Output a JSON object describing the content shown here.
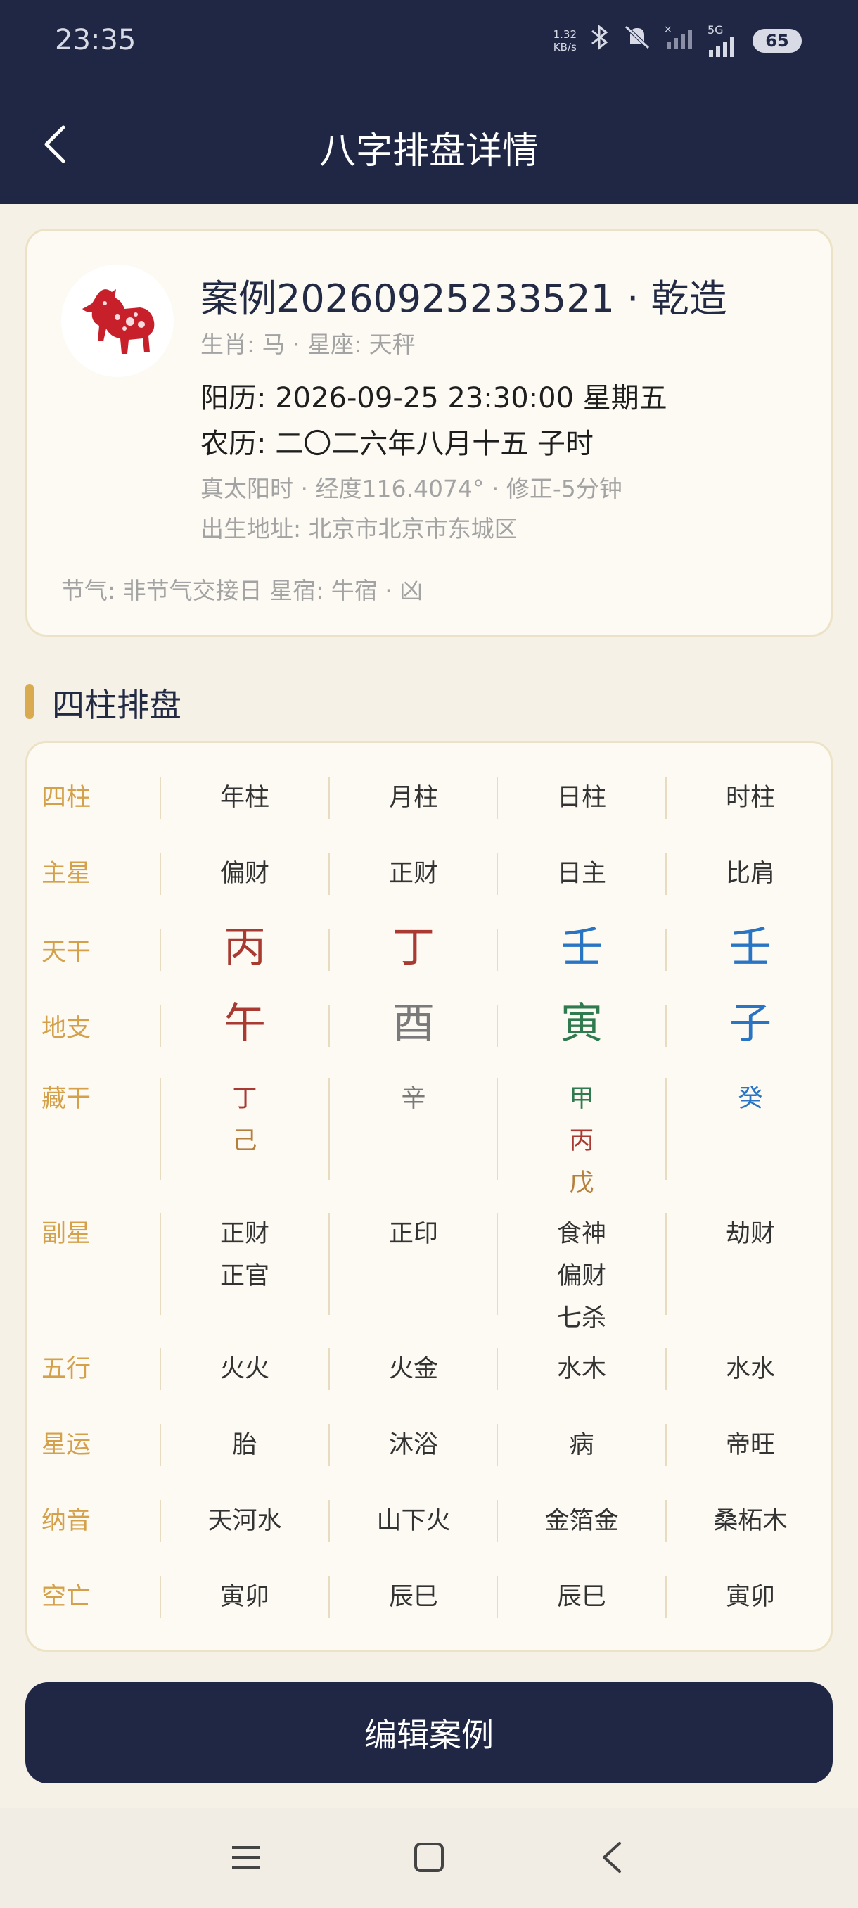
{
  "status": {
    "time": "23:35",
    "net_speed_value": "1.32",
    "net_speed_unit": "KB/s",
    "battery": "65",
    "network_label": "5G"
  },
  "header": {
    "title": "八字排盘详情"
  },
  "profile": {
    "case_title": "案例20260925233521 · 乾造",
    "zodiac_line": "生肖: 马 · 星座: 天秤",
    "solar_date": "阳历: 2026-09-25 23:30:00  星期五",
    "lunar_date": "农历: 二〇二六年八月十五 子时",
    "true_solar": "真太阳时 · 经度116.4074° · 修正-5分钟",
    "birthplace": "出生地址: 北京市北京市东城区",
    "footer": "节气: 非节气交接日  星宿: 牛宿 · 凶"
  },
  "section": {
    "title": "四柱排盘"
  },
  "pillars": {
    "rows": [
      {
        "label": "四柱",
        "cells": [
          [
            "年柱"
          ],
          [
            "月柱"
          ],
          [
            "日柱"
          ],
          [
            "时柱"
          ]
        ]
      },
      {
        "label": "主星",
        "cells": [
          [
            "偏财"
          ],
          [
            "正财"
          ],
          [
            "日主"
          ],
          [
            "比肩"
          ]
        ]
      },
      {
        "label": "天干",
        "cells": [
          [
            "丙"
          ],
          [
            "丁"
          ],
          [
            "壬"
          ],
          [
            "壬"
          ]
        ]
      },
      {
        "label": "地支",
        "cells": [
          [
            "午"
          ],
          [
            "酉"
          ],
          [
            "寅"
          ],
          [
            "子"
          ]
        ]
      },
      {
        "label": "藏干",
        "cells": [
          [
            "丁",
            "己"
          ],
          [
            "辛"
          ],
          [
            "甲",
            "丙",
            "戊"
          ],
          [
            "癸"
          ]
        ]
      },
      {
        "label": "副星",
        "cells": [
          [
            "正财",
            "正官"
          ],
          [
            "正印"
          ],
          [
            "食神",
            "偏财",
            "七杀"
          ],
          [
            "劫财"
          ]
        ]
      },
      {
        "label": "五行",
        "cells": [
          [
            "火火"
          ],
          [
            "火金"
          ],
          [
            "水木"
          ],
          [
            "水水"
          ]
        ]
      },
      {
        "label": "星运",
        "cells": [
          [
            "胎"
          ],
          [
            "沐浴"
          ],
          [
            "病"
          ],
          [
            "帝旺"
          ]
        ]
      },
      {
        "label": "纳音",
        "cells": [
          [
            "天河水"
          ],
          [
            "山下火"
          ],
          [
            "金箔金"
          ],
          [
            "桑柘木"
          ]
        ]
      },
      {
        "label": "空亡",
        "cells": [
          [
            "寅卯"
          ],
          [
            "辰巳"
          ],
          [
            "辰巳"
          ],
          [
            "寅卯"
          ]
        ]
      }
    ],
    "element_colors": {
      "fire": "#a83a32",
      "metal": "#7a7a7a",
      "wood": "#2f7a4e",
      "water": "#2a74c4",
      "earth": "#b5803d"
    }
  },
  "actions": {
    "edit_label": "编辑案例"
  },
  "icons": {
    "back": "chevron-left-icon",
    "avatar": "horse-zodiac-icon",
    "nav_menu": "menu-icon",
    "nav_home": "square-home-icon",
    "nav_back": "triangle-back-icon"
  }
}
